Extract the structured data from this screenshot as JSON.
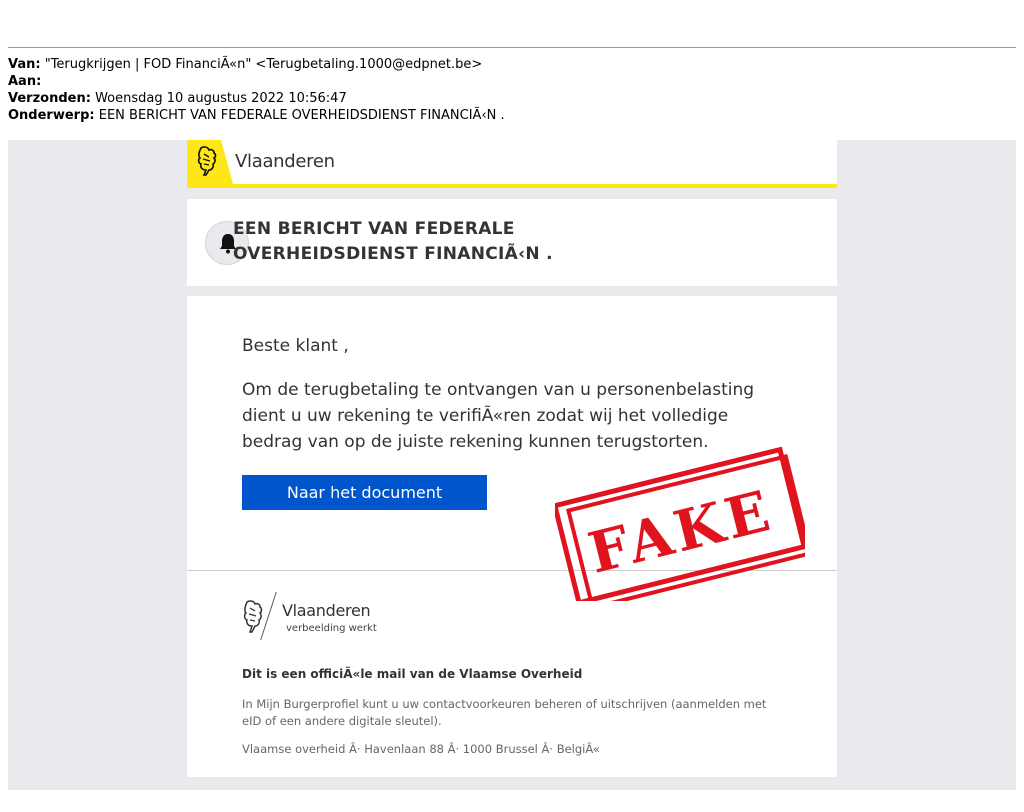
{
  "email_headers": {
    "from_label": "Van:",
    "from_value": "\"Terugkrijgen | FOD FinanciÃ«n\" <Terugbetaling.1000@edpnet.be>",
    "to_label": "Aan:",
    "to_value": "",
    "sent_label": "Verzonden:",
    "sent_value": "Woensdag 10 augustus 2022 10:56:47",
    "subject_label": "Onderwerp:",
    "subject_value": "EEN BERICHT VAN FEDERALE OVERHEIDSDIENST FINANCIÃ‹N ."
  },
  "brand": {
    "name": "Vlaanderen",
    "accent_color": "#ffe615"
  },
  "notice": {
    "icon": "bell-icon",
    "title_line1": "EEN BERICHT VAN FEDERALE",
    "title_line2": "OVERHEIDSDIENST FINANCIÃ‹N ."
  },
  "body": {
    "greeting": "Beste klant ,",
    "paragraph": "Om de terugbetaling te ontvangen van u personenbelasting dient u uw rekening te verifiÃ«ren zodat wij het volledige bedrag van op de juiste rekening kunnen terugstorten.",
    "cta_label": "Naar het document",
    "cta_color": "#0055cc"
  },
  "stamp": {
    "text": "FAKE",
    "color": "#e0141e"
  },
  "footer": {
    "brand_name": "Vlaanderen",
    "tagline": "verbeelding werkt",
    "official_line": "Dit is een officiÃ«le mail van de Vlaamse Overheid",
    "info": "In Mijn Burgerprofiel kunt u uw contactvoorkeuren beheren of uitschrijven (aanmelden met eID of een andere digitale sleutel).",
    "address": "Vlaamse overheid Â· Havenlaan 88 Â· 1000 Brussel Â· BelgiÃ«"
  }
}
